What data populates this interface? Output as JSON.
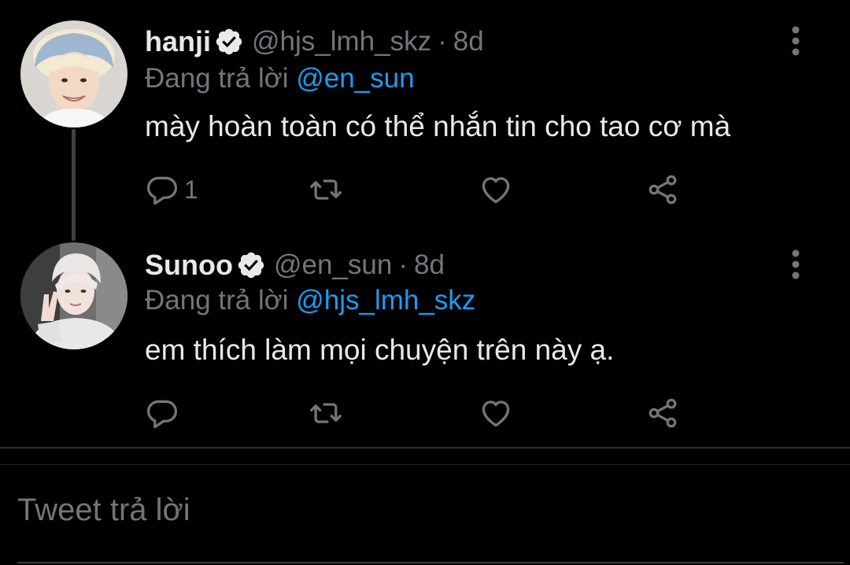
{
  "tweets": [
    {
      "name": "hanji",
      "handle": "@hjs_lmh_skz",
      "separator": "·",
      "time": "8d",
      "replying_prefix": "Đang trả lời",
      "replying_to": "@en_sun",
      "text": "mày hoàn toàn có thể nhắn tin cho tao cơ mà",
      "reply_count": "1"
    },
    {
      "name": "Sunoo",
      "handle": "@en_sun",
      "separator": "·",
      "time": "8d",
      "replying_prefix": "Đang trả lời",
      "replying_to": "@hjs_lmh_skz",
      "text": "em thích làm mọi chuyện trên này ạ.",
      "reply_count": ""
    }
  ],
  "reply_box": {
    "placeholder": "Tweet trả lời"
  },
  "colors": {
    "background": "#000000",
    "primary_text": "#e7e9ea",
    "secondary_text": "#71767b",
    "link": "#1d9bf0",
    "divider": "#2f3336"
  },
  "icons": [
    "verified-badge-icon",
    "more-options-icon",
    "reply-icon",
    "retweet-icon",
    "like-icon",
    "share-icon"
  ]
}
